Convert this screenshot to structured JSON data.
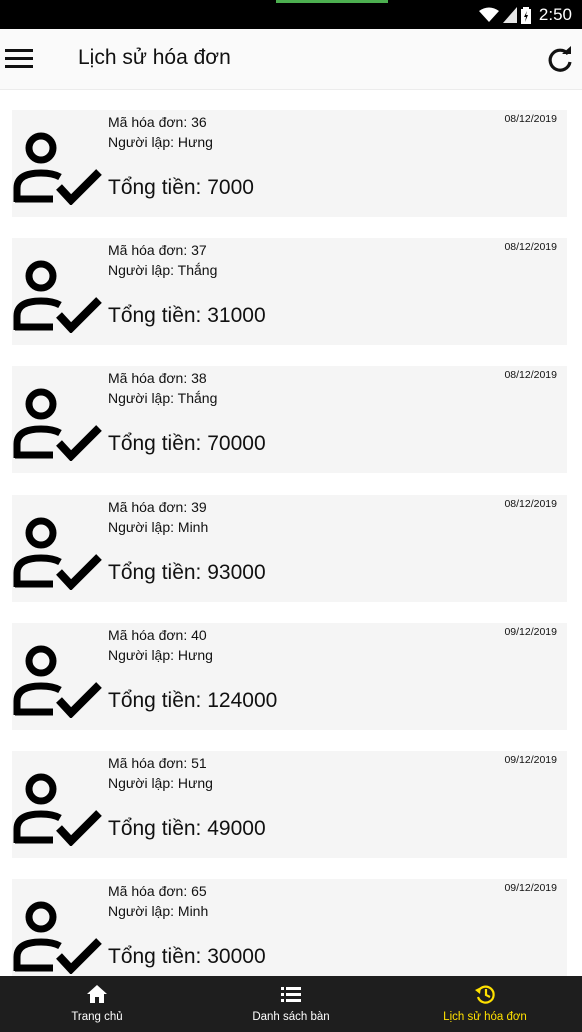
{
  "status_bar": {
    "time": "2:50"
  },
  "app_bar": {
    "title": "Lịch sử hóa đơn",
    "menu_icon": "menu-icon",
    "refresh_icon": "refresh-icon"
  },
  "invoices": [
    {
      "code": "Mã hóa đơn: 36",
      "creator": "Người lập: Hưng",
      "date": "08/12/2019",
      "total": "Tổng tiền: 7000"
    },
    {
      "code": "Mã hóa đơn: 37",
      "creator": "Người lập: Thắng",
      "date": "08/12/2019",
      "total": "Tổng tiền: 31000"
    },
    {
      "code": "Mã hóa đơn: 38",
      "creator": "Người lập: Thắng",
      "date": "08/12/2019",
      "total": "Tổng tiền: 70000"
    },
    {
      "code": "Mã hóa đơn: 39",
      "creator": "Người lập: Minh",
      "date": "08/12/2019",
      "total": "Tổng tiền: 93000"
    },
    {
      "code": "Mã hóa đơn: 40",
      "creator": "Người lập: Hưng",
      "date": "09/12/2019",
      "total": "Tổng tiền: 124000"
    },
    {
      "code": "Mã hóa đơn: 51",
      "creator": "Người lập: Hưng",
      "date": "09/12/2019",
      "total": "Tổng tiền: 49000"
    },
    {
      "code": "Mã hóa đơn: 65",
      "creator": "Người lập: Minh",
      "date": "09/12/2019",
      "total": "Tổng tiền: 30000"
    }
  ],
  "bottom_nav": {
    "items": [
      {
        "label": "Trang chủ",
        "icon": "home-icon"
      },
      {
        "label": "Danh sách bàn",
        "icon": "list-icon"
      },
      {
        "label": "Lịch sử hóa đơn",
        "icon": "history-icon"
      }
    ],
    "active_index": 2,
    "active_color": "#ffe100"
  }
}
